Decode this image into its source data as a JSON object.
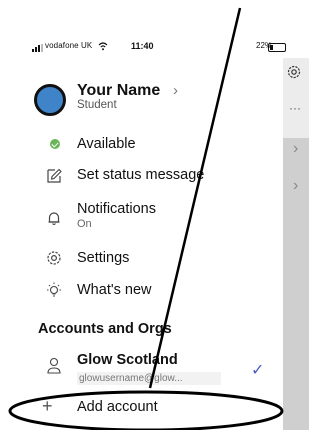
{
  "status_bar": {
    "carrier": "vodafone UK",
    "time": "11:40",
    "battery": "22%"
  },
  "profile": {
    "name": "Your Name",
    "chevron": "›",
    "role": "Student"
  },
  "menu": {
    "available": "Available",
    "status_message": "Set status message",
    "notifications": "Notifications",
    "notifications_state": "On",
    "settings": "Settings",
    "whats_new": "What's new"
  },
  "accounts": {
    "title": "Accounts and Orgs",
    "org_name": "Glow Scotland",
    "org_email": "glowusername@glow...",
    "add_account": "Add account"
  },
  "icons": {
    "available": "check-circle-icon",
    "status": "edit-status-icon",
    "notifications": "bell-icon",
    "settings": "gear-icon",
    "whats_new": "lightbulb-icon",
    "account": "person-icon",
    "add": "plus-icon"
  },
  "colors": {
    "available_green": "#6bb65a",
    "avatar_blue": "#3f83c9",
    "check_blue": "#4a5bc3",
    "dim_pane": "#cfcfcf"
  }
}
